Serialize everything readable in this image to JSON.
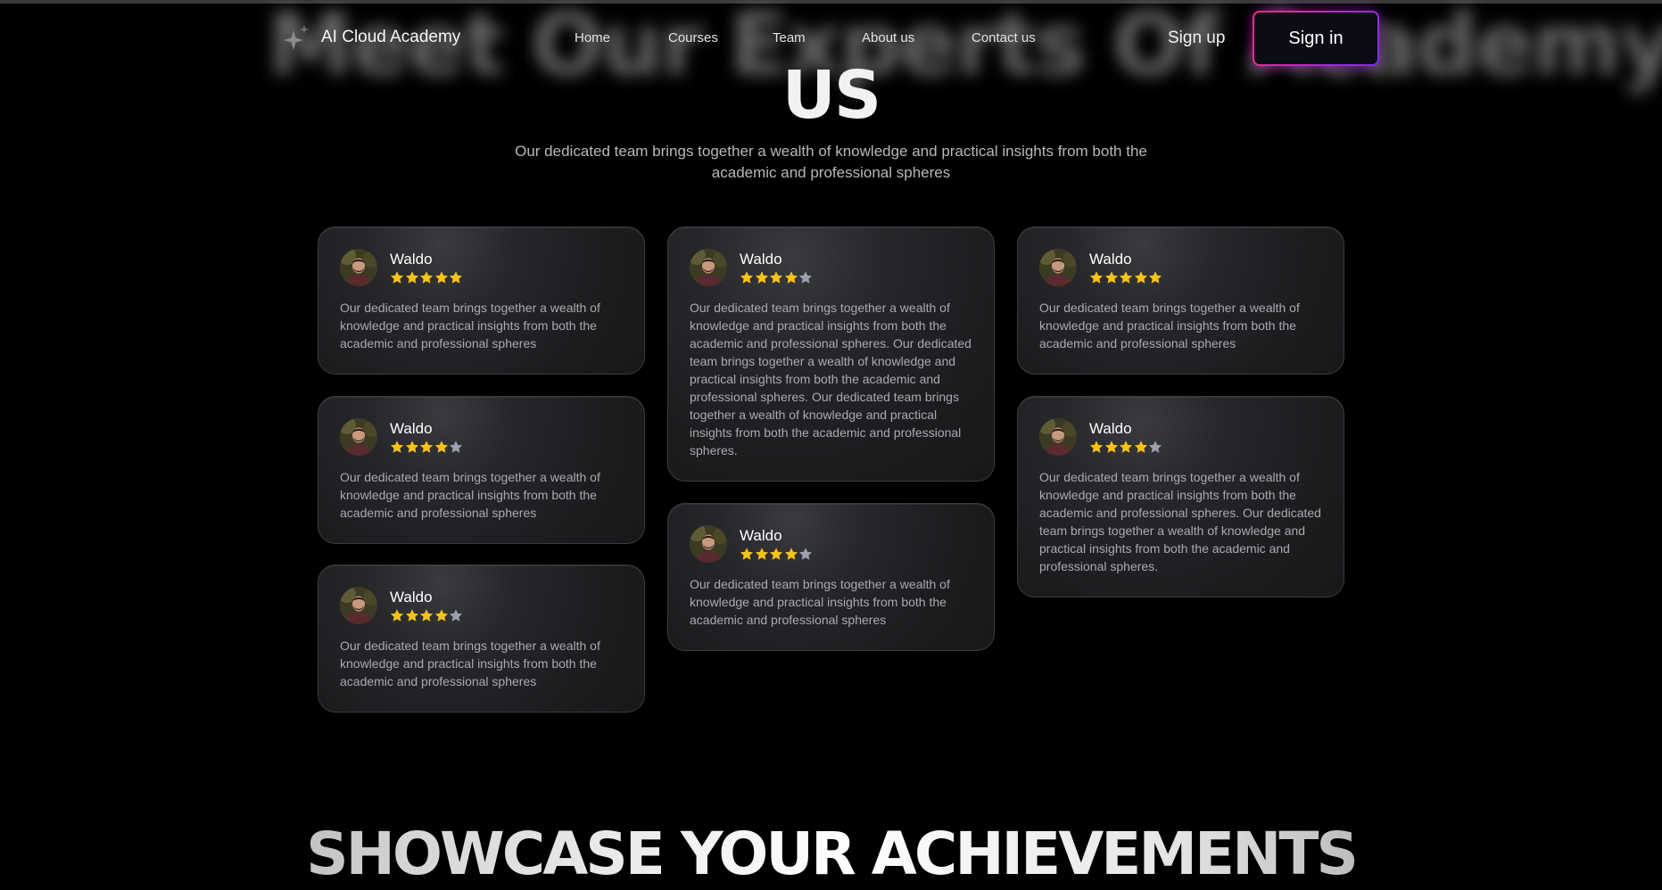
{
  "nav": {
    "brand": "AI Cloud Academy",
    "links": [
      "Home",
      "Courses",
      "Team",
      "About us",
      "Contact us"
    ],
    "signup": "Sign up",
    "signin": "Sign in"
  },
  "hero": {
    "bg_heading": "Meet Our Experts Of Academy",
    "title": "US",
    "subtitle": "Our dedicated team brings together a wealth of knowledge and practical insights from both the academic and professional spheres"
  },
  "testimonials": [
    {
      "name": "Waldo",
      "rating": 5,
      "text": "Our dedicated team brings together a wealth of knowledge and practical insights from both the academic and professional spheres"
    },
    {
      "name": "Waldo",
      "rating": 4,
      "text": "Our dedicated team brings together a wealth of knowledge and practical insights from both the academic and professional spheres"
    },
    {
      "name": "Waldo",
      "rating": 4,
      "text": "Our dedicated team brings together a wealth of knowledge and practical insights from both the academic and professional spheres"
    },
    {
      "name": "Waldo",
      "rating": 4,
      "text": "Our dedicated team brings together a wealth of knowledge and practical insights from both the academic and professional spheres. Our dedicated team brings together a wealth of knowledge and practical insights from both the academic and professional spheres. Our dedicated team brings together a wealth of knowledge and practical insights from both the academic and professional spheres."
    },
    {
      "name": "Waldo",
      "rating": 4,
      "text": "Our dedicated team brings together a wealth of knowledge and practical insights from both the academic and professional spheres"
    },
    {
      "name": "Waldo",
      "rating": 5,
      "text": "Our dedicated team brings together a wealth of knowledge and practical insights from both the academic and professional spheres"
    },
    {
      "name": "Waldo",
      "rating": 4,
      "text": "Our dedicated team brings together a wealth of knowledge and practical insights from both the academic and professional spheres. Our dedicated team brings together a wealth of knowledge and practical insights from both the academic and professional spheres."
    }
  ],
  "showcase": {
    "title": "SHOWCASE YOUR ACHIEVEMENTS"
  },
  "colors": {
    "star_on": "#f8c21a",
    "star_off": "#9aa0ad",
    "signin_gradient": [
      "#ff2c7a",
      "#7a2cff"
    ],
    "background": "#000000"
  },
  "icons": {
    "brand": "sparkle-icon",
    "star": "star-icon"
  }
}
